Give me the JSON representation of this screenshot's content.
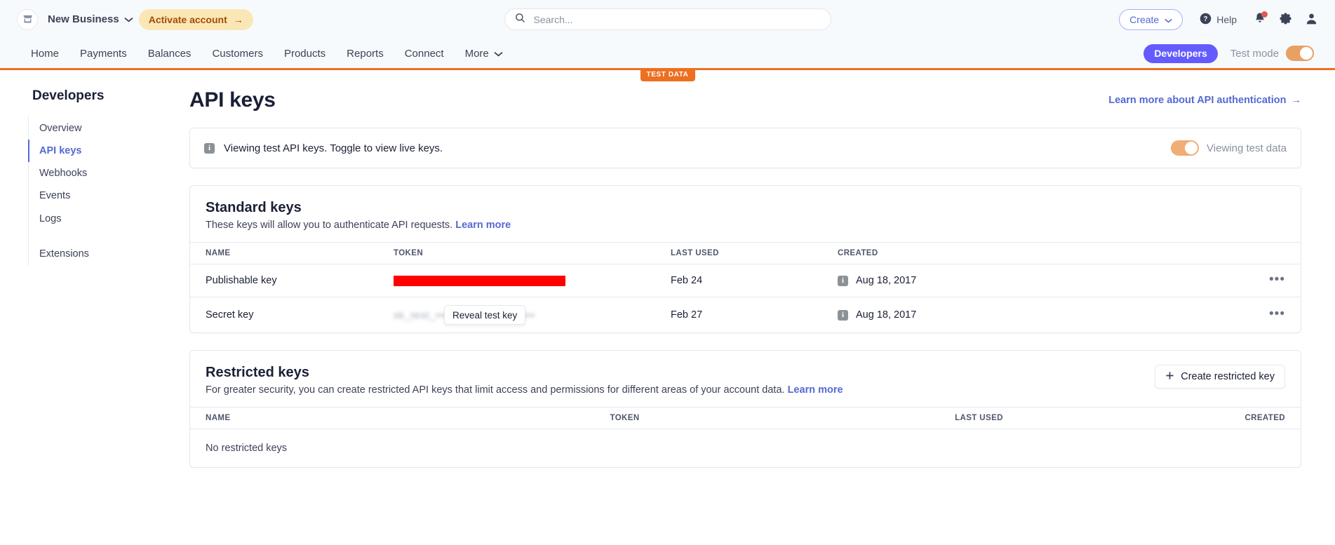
{
  "topbar": {
    "account_name": "New Business",
    "store_icon": "store-icon",
    "account_chevron": "⌄",
    "activate_label": "Activate account",
    "activate_arrow": "→",
    "search_placeholder": "Search...",
    "search_value": "",
    "create_label": "Create",
    "create_chevron": "⌄",
    "help_label": "Help",
    "notifications_icon": "bell-icon",
    "settings_icon": "gear-icon",
    "profile_icon": "user-icon"
  },
  "nav": {
    "items": [
      {
        "label": "Home"
      },
      {
        "label": "Payments"
      },
      {
        "label": "Balances"
      },
      {
        "label": "Customers"
      },
      {
        "label": "Products"
      },
      {
        "label": "Reports"
      },
      {
        "label": "Connect"
      },
      {
        "label": "More",
        "chevron": "⌄"
      }
    ],
    "developers_label": "Developers",
    "test_mode_label": "Test mode",
    "test_mode_on": true,
    "test_data_badge": "TEST DATA",
    "accent_orange": "#ed6f20",
    "accent_purple": "#635bff"
  },
  "sidebar": {
    "title": "Developers",
    "items": [
      {
        "label": "Overview",
        "active": false
      },
      {
        "label": "API keys",
        "active": true
      },
      {
        "label": "Webhooks",
        "active": false
      },
      {
        "label": "Events",
        "active": false
      },
      {
        "label": "Logs",
        "active": false
      }
    ],
    "secondary_items": [
      {
        "label": "Extensions",
        "active": false
      }
    ]
  },
  "page": {
    "title": "API keys",
    "header_link": "Learn more about API authentication",
    "header_link_arrow": "→"
  },
  "notice": {
    "icon": "info-icon",
    "icon_glyph": "i",
    "text": "Viewing test API keys. Toggle to view live keys.",
    "toggle_label": "Viewing test data",
    "toggle_on": true
  },
  "standard_keys": {
    "title": "Standard keys",
    "description": "These keys will allow you to authenticate API requests.",
    "learn_more": "Learn more",
    "columns": [
      "NAME",
      "TOKEN",
      "LAST USED",
      "CREATED"
    ],
    "rows": [
      {
        "name": "Publishable key",
        "token_state": "redacted",
        "token_text": "",
        "last_used": "Feb 24",
        "created": "Aug 18, 2017",
        "created_info_icon": "info-icon",
        "menu": "•••"
      },
      {
        "name": "Secret key",
        "token_state": "hidden",
        "token_text": "sk_test_••••••••••••••••••••••••",
        "reveal_label": "Reveal test key",
        "last_used": "Feb 27",
        "created": "Aug 18, 2017",
        "created_info_icon": "info-icon",
        "menu": "•••"
      }
    ]
  },
  "restricted_keys": {
    "title": "Restricted keys",
    "description": "For greater security, you can create restricted API keys that limit access and permissions for different areas of your account data.",
    "learn_more": "Learn more",
    "create_label": "Create restricted key",
    "create_icon": "plus-icon",
    "columns": [
      "NAME",
      "TOKEN",
      "LAST USED",
      "CREATED"
    ],
    "empty_message": "No restricted keys"
  }
}
